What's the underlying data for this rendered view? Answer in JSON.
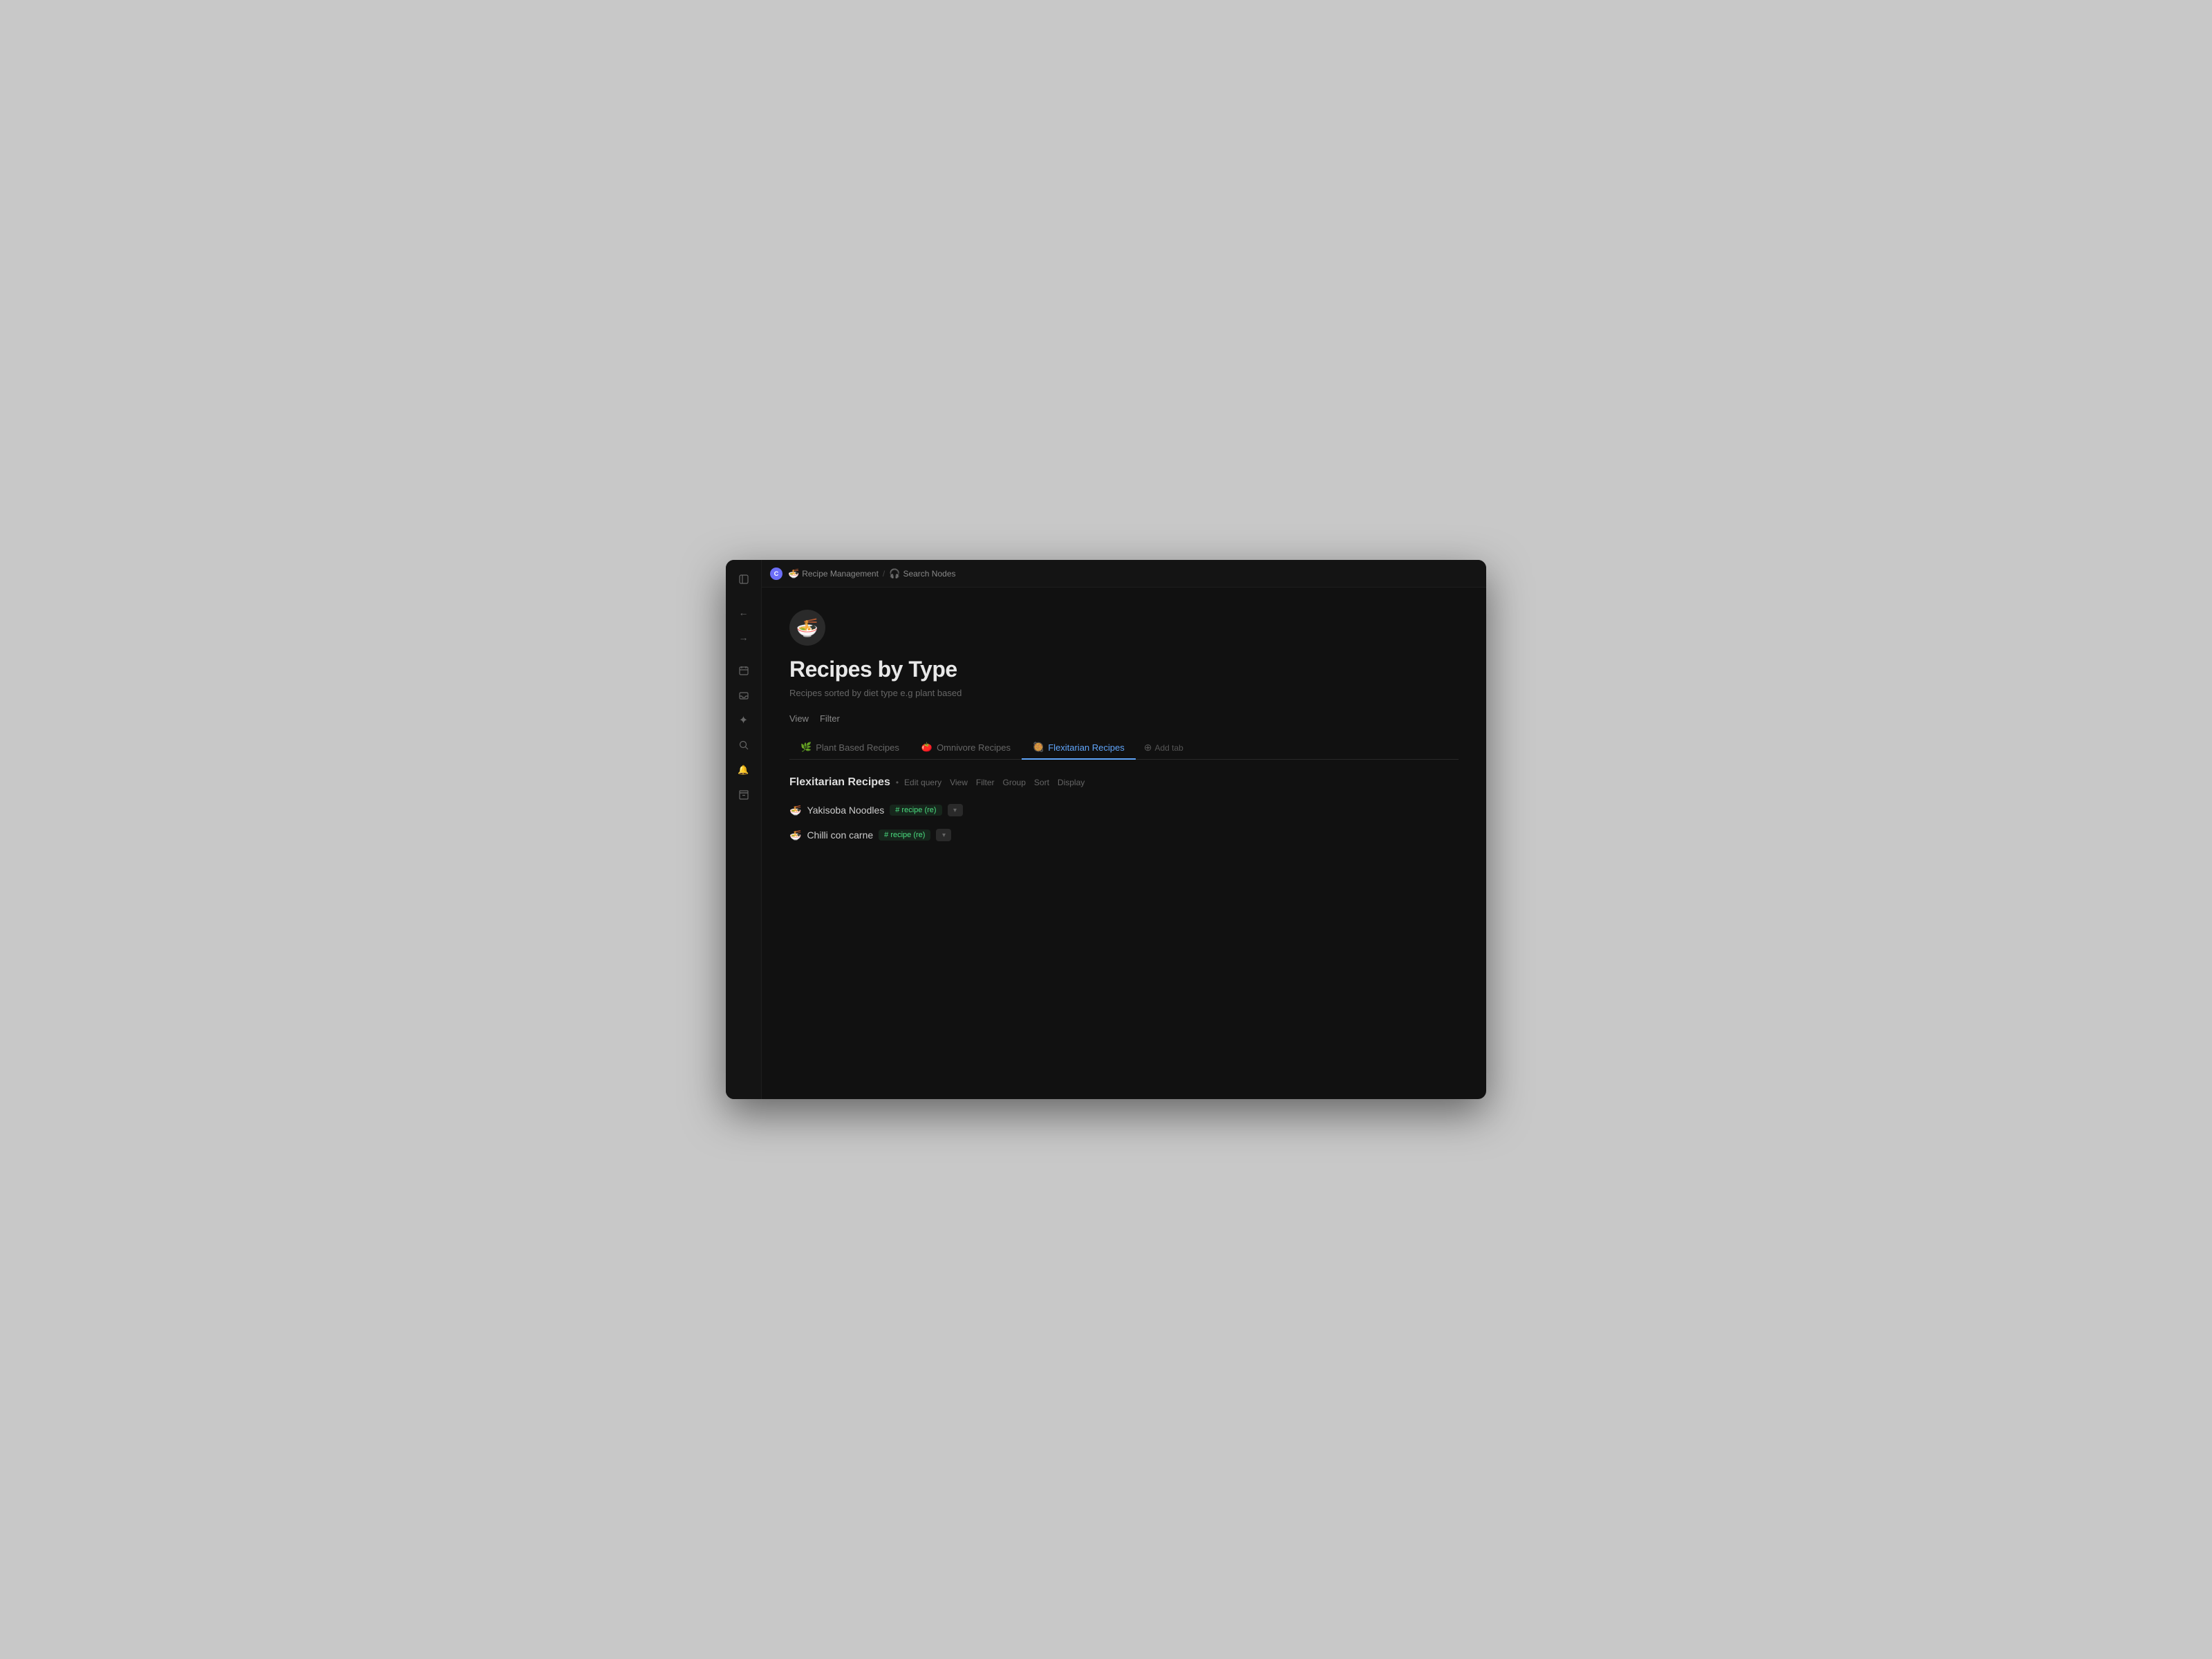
{
  "window": {
    "title": "Recipe Management"
  },
  "topbar": {
    "app_icon_label": "C",
    "breadcrumbs": [
      {
        "emoji": "🍜",
        "label": "Recipe Management"
      },
      {
        "emoji": "🎧",
        "label": "Search Nodes"
      }
    ]
  },
  "sidebar": {
    "icons": [
      {
        "name": "sidebar-toggle-icon",
        "symbol": "⊞",
        "tooltip": "Toggle sidebar"
      },
      {
        "name": "back-icon",
        "symbol": "←",
        "tooltip": "Back"
      },
      {
        "name": "forward-icon",
        "symbol": "→",
        "tooltip": "Forward"
      },
      {
        "name": "calendar-icon",
        "symbol": "▦",
        "tooltip": "Calendar"
      },
      {
        "name": "inbox-icon",
        "symbol": "✉",
        "tooltip": "Inbox"
      },
      {
        "name": "ai-icon",
        "symbol": "✦",
        "tooltip": "AI"
      },
      {
        "name": "search-icon",
        "symbol": "⌕",
        "tooltip": "Search"
      },
      {
        "name": "notifications-icon",
        "symbol": "🔔",
        "tooltip": "Notifications"
      },
      {
        "name": "archive-icon",
        "symbol": "⊟",
        "tooltip": "Archive"
      }
    ]
  },
  "page": {
    "icon": "🍜",
    "title": "Recipes by Type",
    "description": "Recipes sorted by diet type e.g plant based"
  },
  "toolbar": {
    "view_label": "View",
    "filter_label": "Filter"
  },
  "tabs": [
    {
      "id": "plant-based",
      "emoji": "🌿",
      "label": "Plant Based Recipes",
      "active": false
    },
    {
      "id": "omnivore",
      "emoji": "🍅",
      "label": "Omnivore Recipes",
      "active": false
    },
    {
      "id": "flexitarian",
      "emoji": "🥘",
      "label": "Flexitarian Recipes",
      "active": true
    }
  ],
  "add_tab_label": "Add tab",
  "section": {
    "title": "Flexitarian Recipes",
    "dot": "•",
    "actions": [
      {
        "id": "edit-query",
        "label": "Edit query"
      },
      {
        "id": "view",
        "label": "View"
      },
      {
        "id": "filter",
        "label": "Filter"
      },
      {
        "id": "group",
        "label": "Group"
      },
      {
        "id": "sort",
        "label": "Sort"
      },
      {
        "id": "display",
        "label": "Display"
      }
    ]
  },
  "recipes": [
    {
      "id": "yakisoba",
      "icon": "🍜",
      "name": "Yakisoba Noodles",
      "tag": "# recipe (re)"
    },
    {
      "id": "chilli",
      "icon": "🍜",
      "name": "Chilli con carne",
      "tag": "# recipe (re)"
    }
  ]
}
